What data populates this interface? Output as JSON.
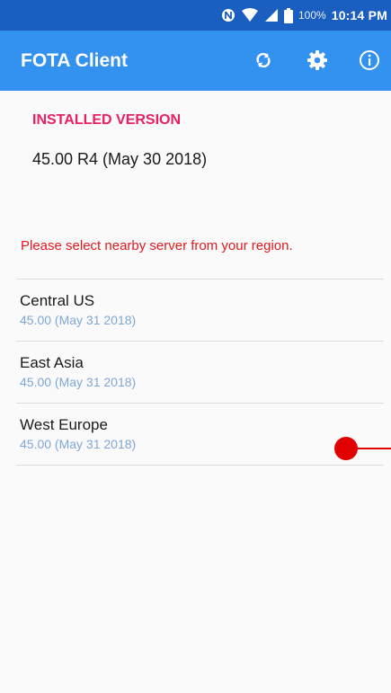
{
  "status_bar": {
    "battery_percent": "100%",
    "time": "10:14 PM",
    "icons": [
      "nfc-icon",
      "wifi-icon",
      "signal-icon",
      "battery-icon"
    ]
  },
  "app_bar": {
    "title": "FOTA Client",
    "actions": [
      "refresh-icon",
      "settings-icon",
      "info-icon"
    ]
  },
  "installed": {
    "heading": "INSTALLED VERSION",
    "version": "45.00 R4 (May 30 2018)"
  },
  "notice": "Please select nearby server from your region.",
  "servers": [
    {
      "name": "Central US",
      "version": "45.00 (May 31 2018)"
    },
    {
      "name": "East Asia",
      "version": "45.00 (May 31 2018)"
    },
    {
      "name": "West Europe",
      "version": "45.00 (May 31 2018)"
    }
  ],
  "colors": {
    "status_bar": "#1a5fbf",
    "app_bar": "#3392f0",
    "heading": "#e91e63",
    "notice": "#e0191e",
    "server_version": "#7fa7d6",
    "touch_marker": "#e00000"
  }
}
